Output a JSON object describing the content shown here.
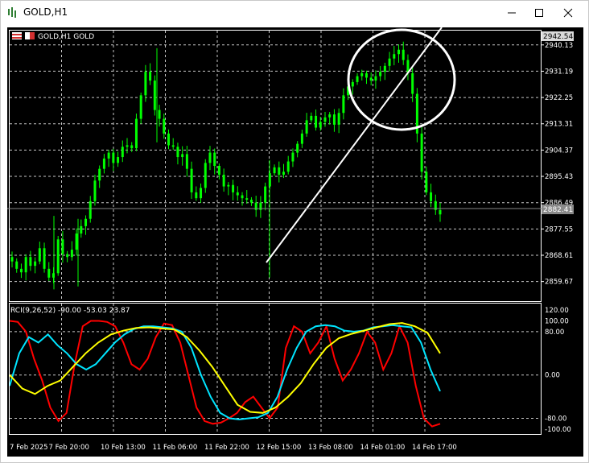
{
  "window": {
    "title": "GOLD,H1",
    "controls": [
      "minimize",
      "maximize",
      "close"
    ]
  },
  "chart": {
    "header_text": "GOLD,H1  GOLD",
    "current_price_label": "2942.54",
    "bid_label": "2882.41",
    "price_ticks": [
      "2940.13",
      "2931.19",
      "2922.25",
      "2913.31",
      "2904.37",
      "2895.43",
      "2886.49",
      "2877.55",
      "2868.61",
      "2859.67"
    ],
    "indicator_header": "RCI(9,26,52) -90.00 -53.03 23.87",
    "indicator_ticks": [
      "120.00",
      "100.00",
      "80.00",
      "0.00",
      "-80.00",
      "-100.00"
    ],
    "time_ticks": [
      "7 Feb 2025",
      "7 Feb 20:00",
      "10 Feb 13:00",
      "11 Feb 06:00",
      "11 Feb 22:00",
      "12 Feb 15:00",
      "13 Feb 08:00",
      "14 Feb 01:00",
      "14 Feb 17:00"
    ],
    "colors": {
      "background": "#000000",
      "candle": "#00ff00",
      "grid": "#c8c8c8",
      "rci_short": "#ff0000",
      "rci_mid": "#00e5ff",
      "rci_long": "#ffff00",
      "annotation": "#ffffff"
    }
  },
  "chart_data": [
    {
      "type": "candlestick",
      "title": "GOLD,H1",
      "ylim": [
        2853.0,
        2945.0
      ],
      "series": [
        {
          "name": "GOLD",
          "values": [
            2866.5,
            2864.0,
            2862.8,
            2868.0,
            2865.0,
            2866.5,
            2871.0,
            2864.0,
            2861.0,
            2862.5,
            2874.0,
            2869.0,
            2868.0,
            2870.5,
            2876.0,
            2878.5,
            2881.0,
            2887.0,
            2894.0,
            2898.0,
            2901.5,
            2903.5,
            2900.0,
            2902.0,
            2905.5,
            2906.0,
            2905.0,
            2915.0,
            2923.0,
            2931.0,
            2928.0,
            2918.0,
            2915.0,
            2910.0,
            2906.0,
            2905.5,
            2902.0,
            2903.0,
            2898.0,
            2890.0,
            2888.0,
            2891.5,
            2900.0,
            2903.5,
            2899.0,
            2896.0,
            2892.0,
            2892.5,
            2890.0,
            2889.0,
            2888.0,
            2887.5,
            2886.5,
            2884.0,
            2886.5,
            2892.0,
            2896.5,
            2898.5,
            2896.0,
            2897.0,
            2900.5,
            2903.5,
            2906.5,
            2910.0,
            2914.5,
            2916.0,
            2912.0,
            2914.0,
            2915.5,
            2916.5,
            2913.0,
            2917.0,
            2923.0,
            2926.0,
            2927.5,
            2929.5,
            2930.5,
            2929.0,
            2928.0,
            2929.5,
            2931.0,
            2933.0,
            2935.5,
            2937.0,
            2938.5,
            2935.0,
            2930.5,
            2923.5,
            2910.0,
            2897.0,
            2890.0,
            2887.0,
            2884.0,
            2882.5
          ]
        }
      ]
    },
    {
      "type": "line",
      "title": "RCI(9,26,52)",
      "ylim": [
        -100,
        120
      ],
      "series": [
        {
          "name": "RCI short",
          "values": [
            100,
            98,
            80,
            30,
            -10,
            -60,
            -85,
            -70,
            20,
            90,
            100,
            100,
            98,
            90,
            60,
            20,
            10,
            30,
            70,
            95,
            92,
            60,
            0,
            -60,
            -85,
            -90,
            -88,
            -80,
            -70,
            -50,
            -40,
            -60,
            -80,
            -60,
            50,
            90,
            80,
            40,
            60,
            90,
            30,
            -10,
            10,
            40,
            80,
            60,
            10,
            40,
            90,
            60,
            -20,
            -80,
            -95,
            -90
          ]
        },
        {
          "name": "RCI mid",
          "values": [
            -20,
            40,
            70,
            60,
            75,
            55,
            40,
            20,
            10,
            20,
            40,
            60,
            75,
            85,
            90,
            90,
            88,
            86,
            80,
            50,
            0,
            -40,
            -70,
            -80,
            -82,
            -80,
            -78,
            -70,
            -40,
            10,
            50,
            80,
            90,
            92,
            90,
            82,
            80,
            82,
            88,
            90,
            92,
            90,
            88,
            60,
            10,
            -30
          ]
        },
        {
          "name": "RCI long",
          "values": [
            0,
            -25,
            -35,
            -20,
            -10,
            15,
            40,
            60,
            75,
            82,
            87,
            88,
            86,
            84,
            70,
            45,
            15,
            -20,
            -55,
            -68,
            -70,
            -60,
            -40,
            -15,
            20,
            50,
            68,
            76,
            82,
            88,
            94,
            96,
            90,
            78,
            40
          ]
        }
      ]
    }
  ]
}
